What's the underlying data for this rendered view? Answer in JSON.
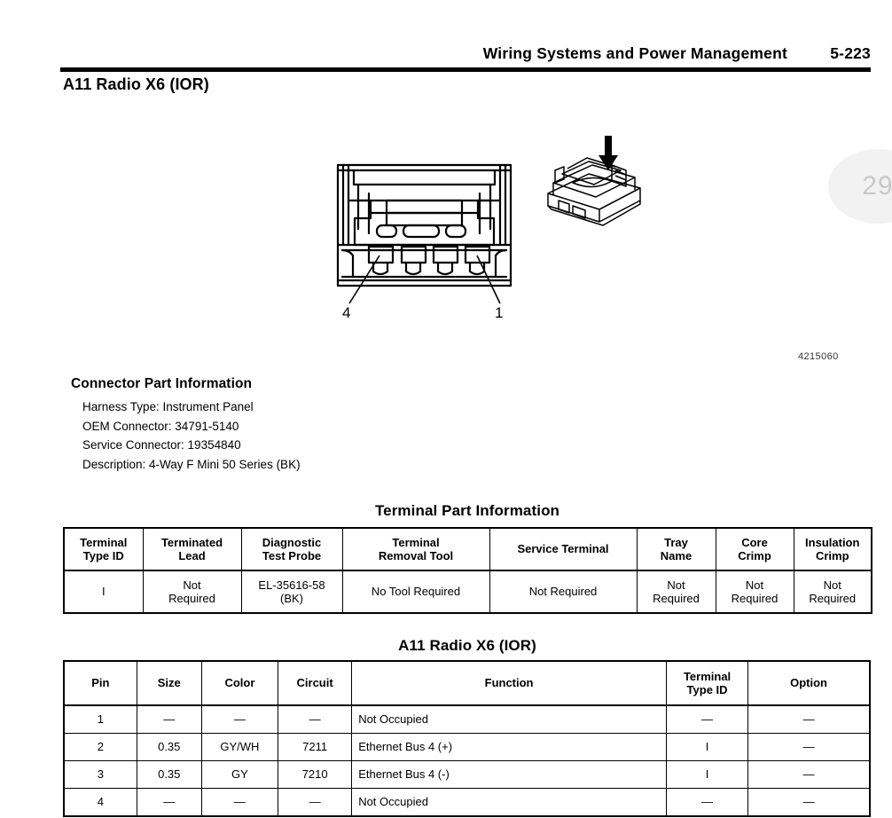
{
  "header": {
    "title": "Wiring Systems and Power Management",
    "page": "5-223"
  },
  "section_title": "A11 Radio X6 (IOR)",
  "watermark": "29",
  "figure": {
    "number": "4215060",
    "callout_left": "4",
    "callout_right": "1",
    "front_view_name": "connector-front-view",
    "iso_view_name": "connector-isometric-view"
  },
  "connector_part_information": {
    "heading": "Connector Part Information",
    "lines": [
      "Harness Type: Instrument Panel",
      "OEM Connector: 34791-5140",
      "Service Connector: 19354840",
      "Description: 4-Way F Mini 50 Series (BK)"
    ]
  },
  "terminal_part_information": {
    "title": "Terminal Part Information",
    "headers": [
      "Terminal\nType ID",
      "Terminated\nLead",
      "Diagnostic\nTest Probe",
      "Terminal\nRemoval Tool",
      "Service Terminal",
      "Tray\nName",
      "Core\nCrimp",
      "Insulation\nCrimp"
    ],
    "rows": [
      [
        "I",
        "Not\nRequired",
        "EL-35616-58\n(BK)",
        "No Tool Required",
        "Not Required",
        "Not\nRequired",
        "Not\nRequired",
        "Not\nRequired"
      ]
    ]
  },
  "pin_table": {
    "title": "A11 Radio X6 (IOR)",
    "headers": [
      "Pin",
      "Size",
      "Color",
      "Circuit",
      "Function",
      "Terminal\nType ID",
      "Option"
    ],
    "rows": [
      [
        "1",
        "—",
        "—",
        "—",
        "Not Occupied",
        "—",
        "—"
      ],
      [
        "2",
        "0.35",
        "GY/WH",
        "7211",
        "Ethernet Bus 4 (+)",
        "I",
        "—"
      ],
      [
        "3",
        "0.35",
        "GY",
        "7210",
        "Ethernet Bus 4 (-)",
        "I",
        "—"
      ],
      [
        "4",
        "—",
        "—",
        "—",
        "Not Occupied",
        "—",
        "—"
      ]
    ]
  }
}
